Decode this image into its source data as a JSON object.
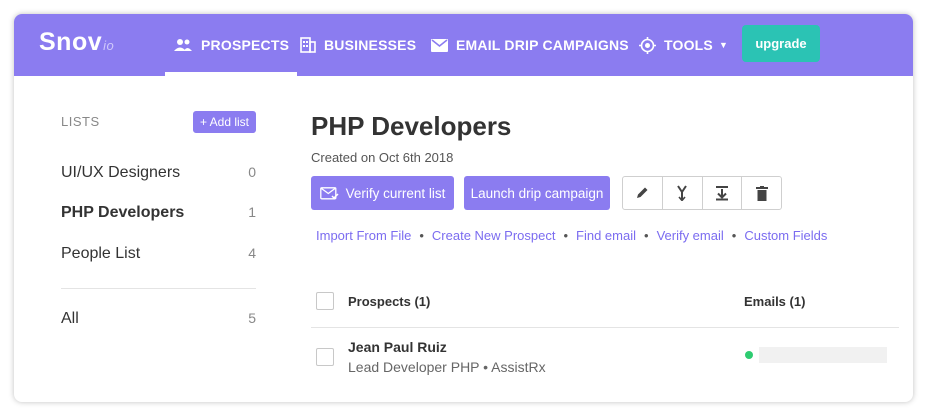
{
  "logo": {
    "name": "Snov",
    "suffix": "io"
  },
  "nav": {
    "items": [
      {
        "label": "PROSPECTS",
        "icon": "people-icon"
      },
      {
        "label": "BUSINESSES",
        "icon": "building-icon"
      },
      {
        "label": "EMAIL DRIP CAMPAIGNS",
        "icon": "envelope-icon"
      },
      {
        "label": "TOOLS",
        "icon": "target-icon"
      }
    ],
    "upgrade_label": "upgrade"
  },
  "sidebar": {
    "heading": "LISTS",
    "add_list_label": "+ Add list",
    "lists": [
      {
        "name": "UI/UX Designers",
        "count": "0"
      },
      {
        "name": "PHP Developers",
        "count": "1"
      },
      {
        "name": "People List",
        "count": "4"
      }
    ],
    "all": {
      "name": "All",
      "count": "5"
    }
  },
  "main": {
    "title": "PHP Developers",
    "created": "Created on Oct 6th 2018",
    "verify_label": "Verify current list",
    "launch_label": "Launch drip campaign",
    "toolbar_icons": [
      "pencil-icon",
      "merge-icon",
      "download-icon",
      "trash-icon"
    ],
    "links": [
      "Import From File",
      "Create New Prospect",
      "Find email",
      "Verify email",
      "Custom Fields"
    ],
    "table": {
      "col_prospects": "Prospects (1)",
      "col_emails": "Emails (1)",
      "rows": [
        {
          "name": "Jean Paul Ruiz",
          "title": "Lead Developer PHP • AssistRx"
        }
      ]
    }
  },
  "colors": {
    "brand": "#8b7cf0",
    "upgrade": "#2bc3b4",
    "link": "#7b6cf0",
    "status_ok": "#2ecc71",
    "arrow": "#f5a623"
  }
}
